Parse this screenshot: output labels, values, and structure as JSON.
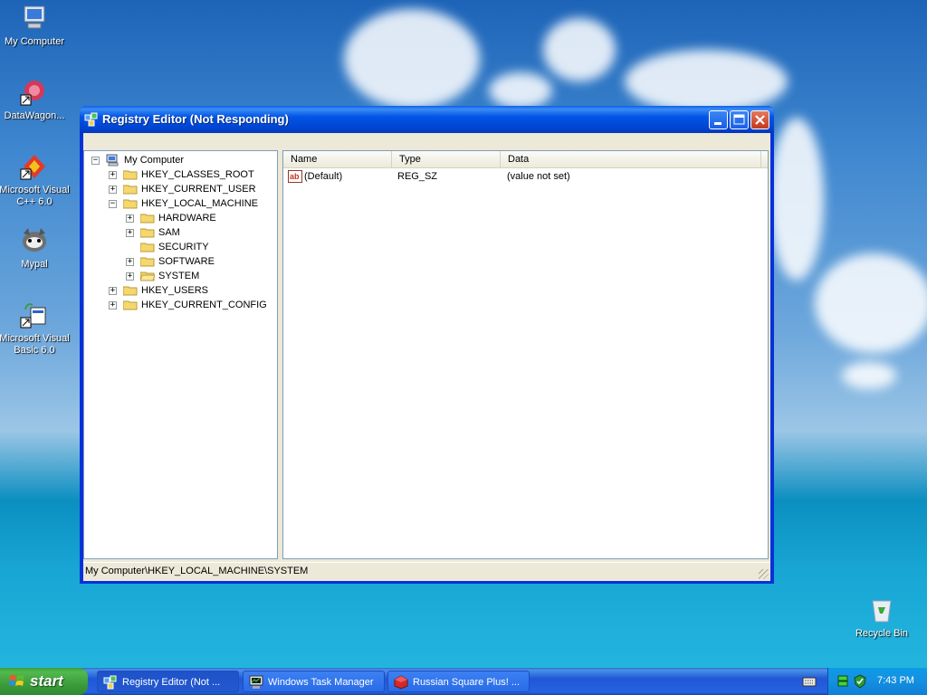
{
  "desktop": {
    "icons": [
      {
        "label": "My Computer"
      },
      {
        "label": "DataWagon..."
      },
      {
        "label": "Microsoft Visual C++ 6.0"
      },
      {
        "label": "Mypal"
      },
      {
        "label": "Microsoft Visual Basic 6.0"
      },
      {
        "label": "Recycle Bin"
      }
    ]
  },
  "window": {
    "title": "Registry Editor (Not Responding)",
    "tree": {
      "root": "My Computer",
      "nodes": [
        {
          "label": "HKEY_CLASSES_ROOT",
          "expander": "+"
        },
        {
          "label": "HKEY_CURRENT_USER",
          "expander": "+"
        },
        {
          "label": "HKEY_LOCAL_MACHINE",
          "expander": "−"
        },
        {
          "label": "HARDWARE",
          "expander": "+"
        },
        {
          "label": "SAM",
          "expander": "+"
        },
        {
          "label": "SECURITY",
          "expander": ""
        },
        {
          "label": "SOFTWARE",
          "expander": "+"
        },
        {
          "label": "SYSTEM",
          "expander": "+"
        },
        {
          "label": "HKEY_USERS",
          "expander": "+"
        },
        {
          "label": "HKEY_CURRENT_CONFIG",
          "expander": "+"
        }
      ]
    },
    "list": {
      "columns": [
        "Name",
        "Type",
        "Data"
      ],
      "rows": [
        {
          "name": "(Default)",
          "type": "REG_SZ",
          "data": "(value not set)"
        }
      ]
    },
    "status": "My Computer\\HKEY_LOCAL_MACHINE\\SYSTEM"
  },
  "taskbar": {
    "start_label": "start",
    "tasks": [
      {
        "label": "Registry Editor (Not ..."
      },
      {
        "label": "Windows Task Manager"
      },
      {
        "label": "Russian Square Plus! ..."
      }
    ],
    "clock": "7:43 PM"
  },
  "colors": {
    "titlebar": "#0255e6",
    "taskbar": "#2157d7",
    "start_button": "#3c9d3c",
    "folder": "#f5d76e"
  },
  "icons": {
    "tree_root": "computer-icon",
    "tree_node": "folder-icon",
    "value": "string-value-icon"
  }
}
